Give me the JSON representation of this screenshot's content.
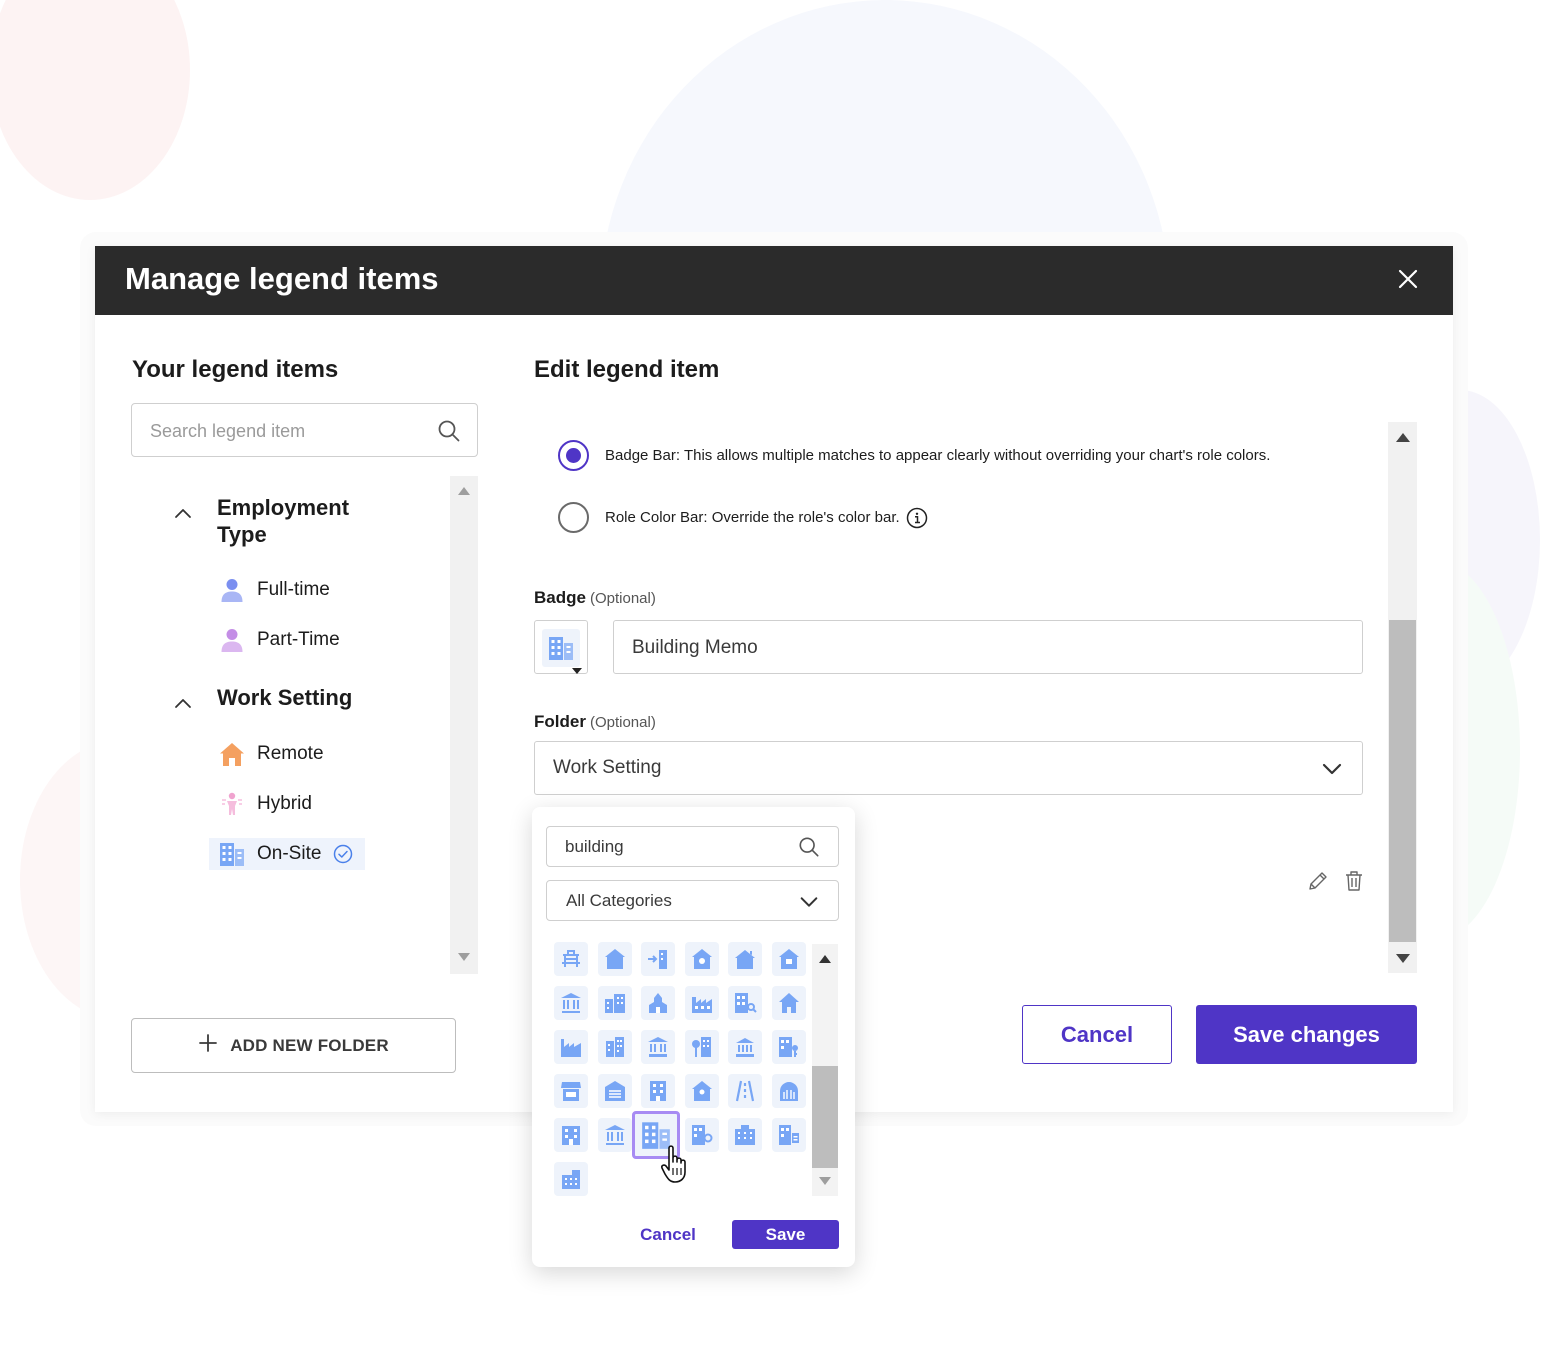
{
  "dialog": {
    "title": "Manage legend items"
  },
  "left_panel": {
    "title": "Your legend items",
    "search_placeholder": "Search legend item",
    "groups": [
      {
        "label": "Employment Type",
        "items": [
          {
            "label": "Full-time",
            "icon": "person-icon"
          },
          {
            "label": "Part-Time",
            "icon": "person-icon"
          }
        ]
      },
      {
        "label": "Work Setting",
        "items": [
          {
            "label": "Remote",
            "icon": "house-icon"
          },
          {
            "label": "Hybrid",
            "icon": "person-commute-icon"
          },
          {
            "label": "On-Site",
            "icon": "building-icon",
            "selected": true
          }
        ]
      }
    ],
    "add_folder_label": "ADD NEW FOLDER"
  },
  "right_panel": {
    "title": "Edit legend item",
    "options": [
      {
        "label": "Badge Bar: This allows multiple matches to appear clearly without overriding your chart's role colors.",
        "checked": true
      },
      {
        "label": "Role Color Bar: Override the role's color bar.",
        "checked": false
      }
    ],
    "badge": {
      "label": "Badge",
      "optional": "(Optional)",
      "value": "Building Memo"
    },
    "folder": {
      "label": "Folder",
      "optional": "(Optional)",
      "value": "Work Setting"
    },
    "cancel_label": "Cancel",
    "save_label": "Save changes"
  },
  "icon_picker": {
    "search_value": "building",
    "category_value": "All Categories",
    "cancel_label": "Cancel",
    "save_label": "Save"
  },
  "colors": {
    "accent": "#4f35c6",
    "header_bg": "#2b2b2b",
    "icon_blue": "#78a6f5",
    "selected_outline": "#a78bf3"
  }
}
